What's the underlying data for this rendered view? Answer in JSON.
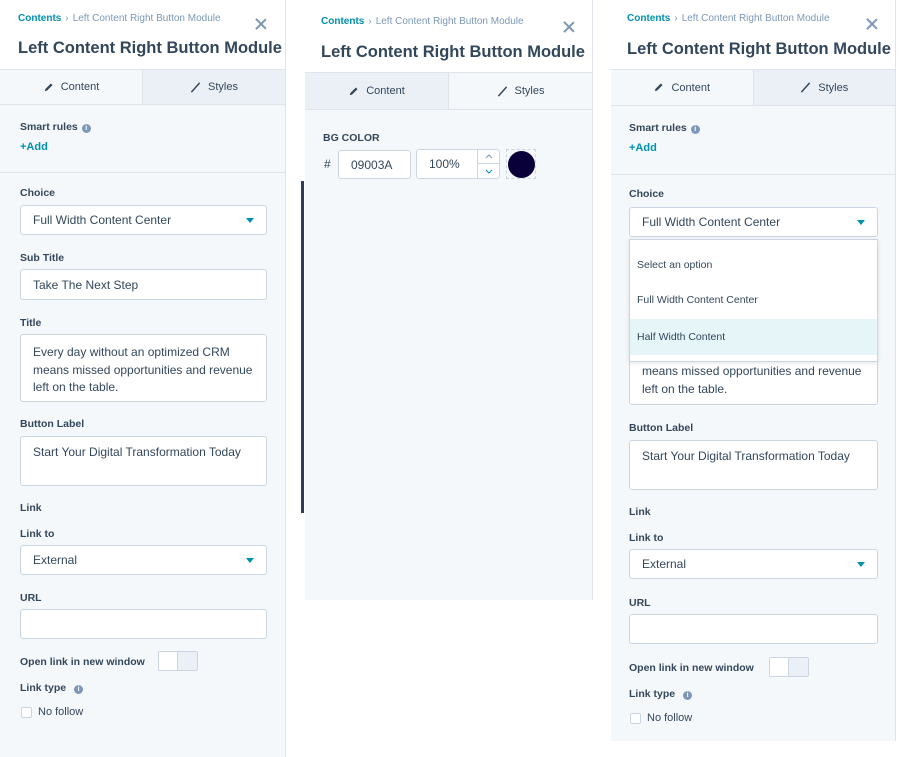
{
  "breadcrumb": {
    "root": "Contents",
    "current": "Left Content Right Button Module"
  },
  "module_title": "Left Content Right Button Module",
  "tabs": {
    "content": "Content",
    "styles": "Styles"
  },
  "smart_rules": {
    "label": "Smart rules",
    "add": "+Add"
  },
  "choice": {
    "label": "Choice",
    "value": "Full Width Content Center"
  },
  "sub_title": {
    "label": "Sub Title",
    "value": "Take The Next Step"
  },
  "title": {
    "label": "Title",
    "value": "Every day without an optimized CRM means missed opportunities and revenue left on the table.",
    "partial_visible": "means missed opportunities and revenue left on the table."
  },
  "button_label": {
    "label": "Button Label",
    "value": "Start Your Digital Transformation Today"
  },
  "link": {
    "section_label": "Link",
    "link_to_label": "Link to",
    "link_to_value": "External",
    "url_label": "URL",
    "url_value": ""
  },
  "open_new_window": {
    "label": "Open link in new window",
    "enabled": false
  },
  "link_type": {
    "label": "Link type",
    "no_follow_label": "No follow",
    "no_follow_checked": false
  },
  "styles": {
    "bg_color_label": "BG COLOR",
    "hash": "#",
    "hex_value": "09003A",
    "opacity_value": "100%",
    "swatch_color": "#09003A"
  },
  "choice_dropdown": {
    "options": [
      "Select an option",
      "Full Width Content Center",
      "Half Width Content"
    ],
    "highlighted": "Half Width Content"
  },
  "colors": {
    "accent": "#0091ae",
    "text": "#33475b",
    "panel_bg": "#f5f8fa",
    "border": "#cbd6e2",
    "sidebar_bar": "#2d3e50"
  }
}
